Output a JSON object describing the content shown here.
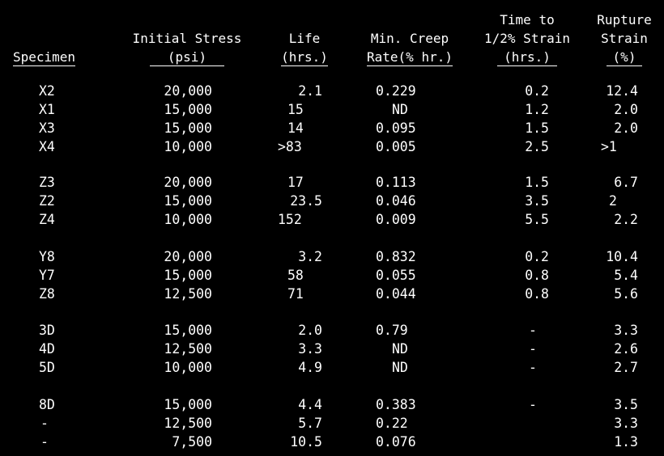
{
  "headers": {
    "specimen": [
      "",
      "",
      "Specimen"
    ],
    "stress": [
      "",
      "Initial Stress",
      "(psi)"
    ],
    "life": [
      "",
      "Life",
      "(hrs.)"
    ],
    "creep": [
      "",
      "Min. Creep",
      "Rate(% hr.)"
    ],
    "time": [
      "Time to",
      "1/2% Strain",
      "(hrs.)"
    ],
    "rupture": [
      "Rupture",
      "Strain",
      "(%)"
    ]
  },
  "rows": [
    {
      "specimen": "X2",
      "stress": "20,000",
      "life": "2.1",
      "creep": "0.229",
      "time": "0.2",
      "rupture": "12.4"
    },
    {
      "specimen": "X1",
      "stress": "15,000",
      "life": "15",
      "creep": "ND",
      "time": "1.2",
      "rupture": "2.0"
    },
    {
      "specimen": "X3",
      "stress": "15,000",
      "life": "14",
      "creep": "0.095",
      "time": "1.5",
      "rupture": "2.0"
    },
    {
      "specimen": "X4",
      "stress": "10,000",
      "life": ">83",
      "creep": "0.005",
      "time": "2.5",
      "rupture": ">1"
    },
    {
      "specimen": "Z3",
      "stress": "20,000",
      "life": "17",
      "creep": "0.113",
      "time": "1.5",
      "rupture": "6.7"
    },
    {
      "specimen": "Z2",
      "stress": "15,000",
      "life": "23.5",
      "creep": "0.046",
      "time": "3.5",
      "rupture": "2"
    },
    {
      "specimen": "Z4",
      "stress": "10,000",
      "life": "152",
      "creep": "0.009",
      "time": "5.5",
      "rupture": "2.2"
    },
    {
      "specimen": "Y8",
      "stress": "20,000",
      "life": "3.2",
      "creep": "0.832",
      "time": "0.2",
      "rupture": "10.4"
    },
    {
      "specimen": "Y7",
      "stress": "15,000",
      "life": "58",
      "creep": "0.055",
      "time": "0.8",
      "rupture": "5.4"
    },
    {
      "specimen": "Z8",
      "stress": "12,500",
      "life": "71",
      "creep": "0.044",
      "time": "0.8",
      "rupture": "5.6"
    },
    {
      "specimen": "3D",
      "stress": "15,000",
      "life": "2.0",
      "creep": "0.79",
      "time": "-",
      "rupture": "3.3"
    },
    {
      "specimen": "4D",
      "stress": "12,500",
      "life": "3.3",
      "creep": "ND",
      "time": "-",
      "rupture": "2.6"
    },
    {
      "specimen": "5D",
      "stress": "10,000",
      "life": "4.9",
      "creep": "ND",
      "time": "-",
      "rupture": "2.7"
    },
    {
      "specimen": "8D",
      "stress": "15,000",
      "life": "4.4",
      "creep": "0.383",
      "time": "-",
      "rupture": "3.5"
    },
    {
      "specimen": "-",
      "stress": "12,500",
      "life": "5.7",
      "creep": "0.22",
      "time": "",
      "rupture": "3.3"
    },
    {
      "specimen": "-",
      "stress": "7,500",
      "life": "10.5",
      "creep": "0.076",
      "time": "",
      "rupture": "1.3"
    }
  ]
}
